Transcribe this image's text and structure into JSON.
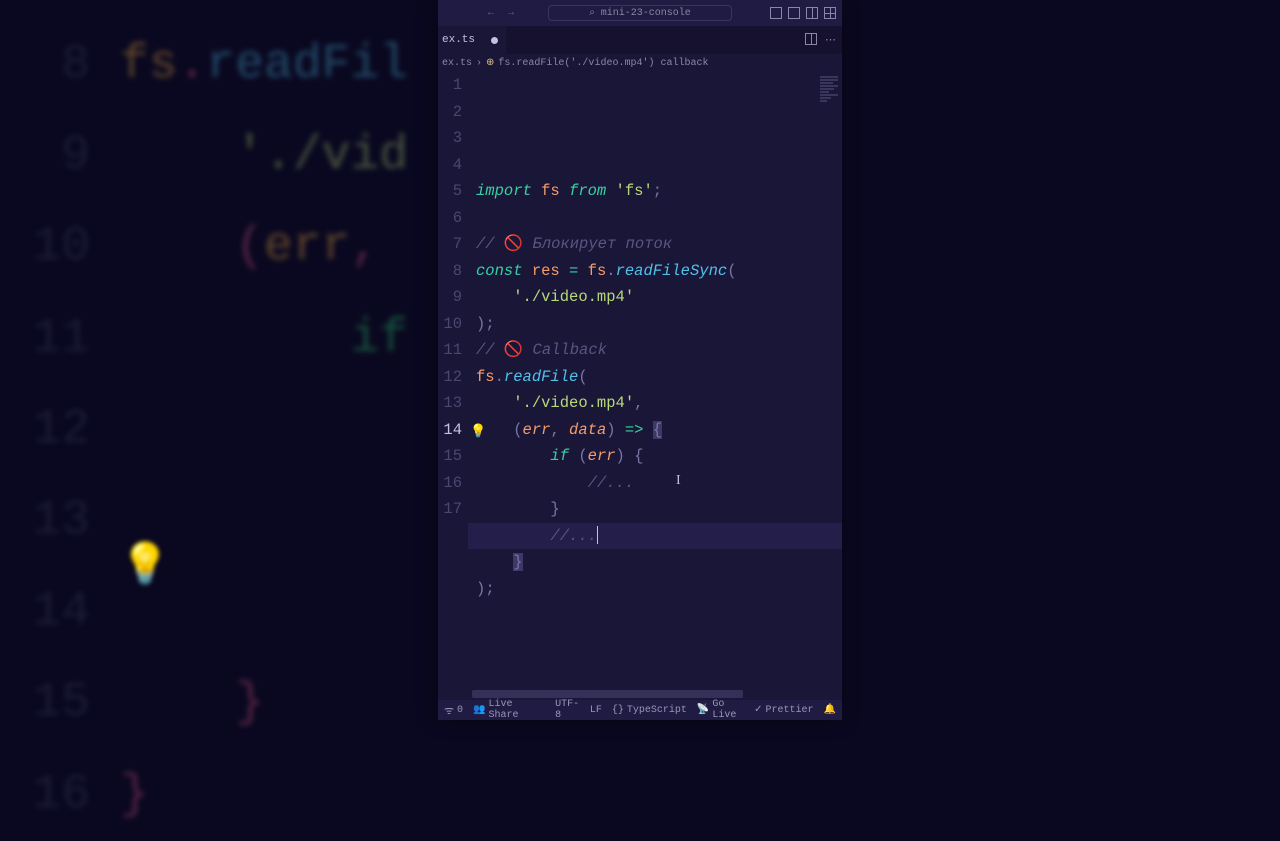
{
  "background_code": {
    "lines": [
      {
        "n": "8",
        "parts": [
          {
            "t": "fs",
            "c": "var"
          },
          {
            "t": ".",
            "c": "punc"
          },
          {
            "t": "readFil",
            "c": "fn"
          }
        ]
      },
      {
        "n": "9",
        "parts": [
          {
            "t": "    '",
            "c": "str"
          },
          {
            "t": "./vid",
            "c": "str"
          }
        ]
      },
      {
        "n": "10",
        "parts": [
          {
            "t": "    (",
            "c": "punc"
          },
          {
            "t": "err",
            "c": "var"
          },
          {
            "t": ", ",
            "c": "punc"
          }
        ]
      },
      {
        "n": "11",
        "parts": [
          {
            "t": "        if",
            "c": "kw"
          }
        ]
      },
      {
        "n": "12",
        "parts": [
          {
            "t": "",
            "c": ""
          }
        ]
      },
      {
        "n": "13",
        "parts": [
          {
            "t": "",
            "c": ""
          }
        ]
      },
      {
        "n": "14",
        "parts": [
          {
            "t": "",
            "c": ""
          }
        ]
      },
      {
        "n": "15",
        "parts": [
          {
            "t": "    }",
            "c": "punc"
          }
        ]
      },
      {
        "n": "16",
        "parts": [
          {
            "t": "}",
            "c": "punc"
          }
        ]
      }
    ]
  },
  "titlebar": {
    "project": "mini-23-console",
    "nav_back": "←",
    "nav_fwd": "→",
    "search_icon": "⌕"
  },
  "tab": {
    "filename": "ex.ts",
    "modified": true
  },
  "breadcrumb": {
    "file": "ex.ts",
    "symbol": "fs.readFile('./video.mp4') callback",
    "sep": "›"
  },
  "code": {
    "active_line": 14,
    "lines": [
      {
        "n": 1,
        "tokens": [
          [
            "kw-import",
            "import"
          ],
          [
            "",
            ""
          ],
          [
            "ident-fs",
            " fs"
          ],
          [
            "",
            ""
          ],
          [
            "kw-from",
            " from"
          ],
          [
            "",
            ""
          ],
          [
            "str",
            " 'fs'"
          ],
          [
            "punc",
            ";"
          ]
        ]
      },
      {
        "n": 2,
        "tokens": []
      },
      {
        "n": 3,
        "tokens": [
          [
            "comment",
            "// "
          ],
          [
            "emoji",
            "🚫"
          ],
          [
            "comment",
            " Блокирует поток"
          ]
        ]
      },
      {
        "n": 4,
        "tokens": [
          [
            "kw-const",
            "const"
          ],
          [
            "ident-var",
            " res"
          ],
          [
            "op",
            " ="
          ],
          [
            "ident-fs",
            " fs"
          ],
          [
            "punc",
            "."
          ],
          [
            "fn-call",
            "readFileSync"
          ],
          [
            "punc",
            "("
          ]
        ]
      },
      {
        "n": 5,
        "tokens": [
          [
            "",
            "    "
          ],
          [
            "str",
            "'./video.mp4'"
          ]
        ]
      },
      {
        "n": 6,
        "tokens": [
          [
            "punc",
            ")"
          ],
          [
            "punc",
            ";"
          ]
        ]
      },
      {
        "n": 7,
        "tokens": [
          [
            "comment",
            "// "
          ],
          [
            "emoji",
            "🚫"
          ],
          [
            "comment",
            " Callback"
          ]
        ]
      },
      {
        "n": 8,
        "tokens": [
          [
            "ident-fs",
            "fs"
          ],
          [
            "punc",
            "."
          ],
          [
            "fn-call",
            "readFile"
          ],
          [
            "punc",
            "("
          ]
        ]
      },
      {
        "n": 9,
        "tokens": [
          [
            "",
            "    "
          ],
          [
            "str",
            "'./video.mp4'"
          ],
          [
            "punc",
            ","
          ]
        ]
      },
      {
        "n": 10,
        "tokens": [
          [
            "",
            "    "
          ],
          [
            "punc",
            "("
          ],
          [
            "ident-param",
            "err"
          ],
          [
            "punc",
            ", "
          ],
          [
            "ident-param",
            "data"
          ],
          [
            "punc",
            ")"
          ],
          [
            "arrow",
            " => "
          ],
          [
            "punc hl-bracket",
            "{"
          ]
        ]
      },
      {
        "n": 11,
        "tokens": [
          [
            "",
            "        "
          ],
          [
            "kw-if",
            "if"
          ],
          [
            "",
            ""
          ],
          [
            "punc",
            " ("
          ],
          [
            "ident-param",
            "err"
          ],
          [
            "punc",
            ")"
          ],
          [
            "",
            ""
          ],
          [
            "punc",
            " {"
          ]
        ]
      },
      {
        "n": 12,
        "tokens": [
          [
            "",
            "            "
          ],
          [
            "comment",
            "//..."
          ]
        ]
      },
      {
        "n": 13,
        "tokens": [
          [
            "",
            "        "
          ],
          [
            "punc",
            "}"
          ]
        ]
      },
      {
        "n": 14,
        "tokens": [
          [
            "",
            "        "
          ],
          [
            "comment",
            "//..."
          ]
        ],
        "cursor": true
      },
      {
        "n": 15,
        "tokens": [
          [
            "",
            "    "
          ],
          [
            "punc hl-bracket",
            "}"
          ]
        ]
      },
      {
        "n": 16,
        "tokens": [
          [
            "punc",
            ")"
          ],
          [
            "punc",
            ";"
          ]
        ]
      },
      {
        "n": 17,
        "tokens": []
      }
    ]
  },
  "statusbar": {
    "remote": "0",
    "liveshare": "Live Share",
    "encoding": "UTF-8",
    "eol": "LF",
    "lang": "TypeScript",
    "golive": "Go Live",
    "prettier": "Prettier"
  },
  "icons": {
    "lightbulb": "💡",
    "broadcast": "ᯤ",
    "bell": "🔔",
    "check": "✓",
    "braces": "{}",
    "symbol": "⊕"
  }
}
